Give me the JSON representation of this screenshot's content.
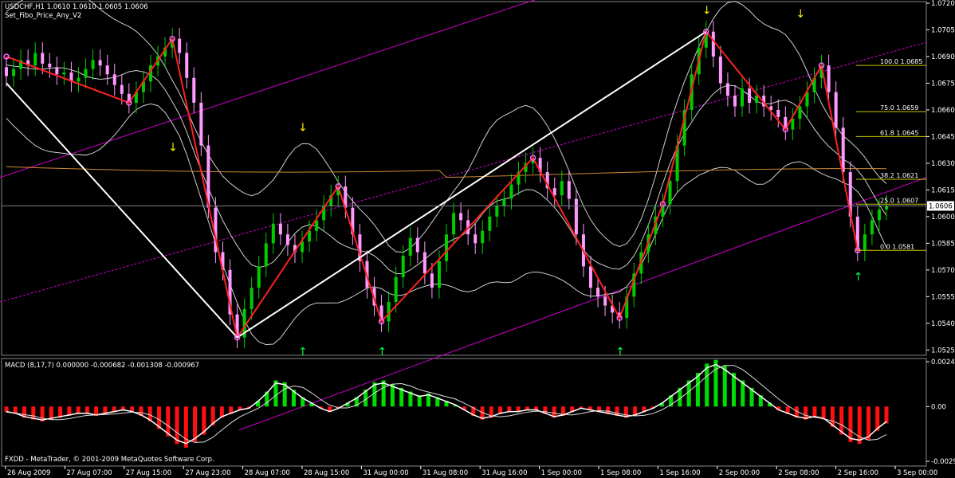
{
  "header": {
    "symbol_line": "USDCHF,H1  1.0610 1.0610 1.0605 1.0606",
    "indicator_name": "Set_Fibo_Price_Any_V2"
  },
  "macd": {
    "label": "MACD  (8,17,7) 0.000000 -0.000682 -0.001308 -0.000967",
    "copyright": "FXDD - MetaTrader, © 2001-2009 MetaQuotes Software Corp."
  },
  "colors": {
    "background": "#000000",
    "bull_candle": "#00cc00",
    "bear_candle": "#ff99ff",
    "zigzag": "#ff2020",
    "channel": "#cc00cc",
    "fibo": "#c8c800",
    "macd_pos": "#00dd00",
    "macd_neg": "#ff1010",
    "bands": "#cfcfcf",
    "ma": "#cc8833",
    "current_price_box": "#ffffff"
  },
  "chart_data": [
    {
      "type": "candlestick",
      "title": "USDCHF,H1",
      "ylim": [
        1.0522,
        1.072
      ],
      "y_ticks": [
        "1.0720",
        "1.0705",
        "1.0690",
        "1.0675",
        "1.0660",
        "1.0645",
        "1.0630",
        "1.0615",
        "1.0600",
        "1.0585",
        "1.0570",
        "1.0555",
        "1.0540",
        "1.0525"
      ],
      "current_price": "1.0606",
      "x_ticks": [
        "26 Aug 2009",
        "27 Aug 07:00",
        "27 Aug 15:00",
        "27 Aug 23:00",
        "28 Aug 07:00",
        "28 Aug 15:00",
        "31 Aug 00:00",
        "31 Aug 08:00",
        "31 Aug 16:00",
        "1 Sep 00:00",
        "1 Sep 08:00",
        "1 Sep 16:00",
        "2 Sep 00:00",
        "2 Sep 08:00",
        "2 Sep 16:00",
        "3 Sep 00:00"
      ],
      "fibo_levels": [
        {
          "label": "100.0  1.0685",
          "price": 1.0685
        },
        {
          "label": "75.0  1.0659",
          "price": 1.0659
        },
        {
          "label": "61.8  1.0645",
          "price": 1.0645
        },
        {
          "label": "38.2  1.0621",
          "price": 1.0621
        },
        {
          "label": "25.0  1.0607",
          "price": 1.0607
        },
        {
          "label": "0.0  1.0581",
          "price": 1.0581
        }
      ],
      "zigzag_red": [
        [
          1.069,
          1.0664
        ],
        [
          1.0664,
          1.07
        ],
        [
          1.07,
          1.0532
        ],
        [
          1.0532,
          1.0617
        ],
        [
          1.0617,
          1.0541
        ],
        [
          1.0541,
          1.0633
        ],
        [
          1.0633,
          1.0543
        ],
        [
          1.0543,
          1.0607
        ],
        [
          1.0607,
          1.0704
        ],
        [
          1.0704,
          1.0649
        ],
        [
          1.0649,
          1.0685
        ],
        [
          1.0685,
          1.0581
        ]
      ],
      "zigzag_white": [
        [
          1.0675,
          1.0532
        ],
        [
          1.0532,
          1.0704
        ]
      ],
      "closes": [
        1.0679,
        1.0683,
        1.0688,
        1.0685,
        1.0692,
        1.0686,
        1.0684,
        1.068,
        1.0681,
        1.0676,
        1.0678,
        1.0683,
        1.0688,
        1.0685,
        1.068,
        1.0674,
        1.0669,
        1.0664,
        1.067,
        1.0676,
        1.0685,
        1.069,
        1.0695,
        1.07,
        1.0692,
        1.0678,
        1.0664,
        1.064,
        1.0605,
        1.058,
        1.057,
        1.0545,
        1.0532,
        1.0548,
        1.056,
        1.0572,
        1.0585,
        1.0596,
        1.059,
        1.0584,
        1.058,
        1.0586,
        1.0592,
        1.0598,
        1.0606,
        1.0612,
        1.0617,
        1.0605,
        1.059,
        1.0575,
        1.056,
        1.055,
        1.0541,
        1.0552,
        1.0566,
        1.0578,
        1.0588,
        1.058,
        1.0568,
        1.056,
        1.0575,
        1.059,
        1.0602,
        1.0598,
        1.059,
        1.0585,
        1.0592,
        1.06,
        1.0606,
        1.061,
        1.0618,
        1.0625,
        1.063,
        1.0633,
        1.0625,
        1.0616,
        1.0612,
        1.062,
        1.061,
        1.059,
        1.0572,
        1.056,
        1.0555,
        1.055,
        1.0546,
        1.0543,
        1.0555,
        1.0568,
        1.058,
        1.059,
        1.06,
        1.0607,
        1.062,
        1.064,
        1.066,
        1.068,
        1.0695,
        1.0704,
        1.069,
        1.0675,
        1.0668,
        1.0662,
        1.0672,
        1.0664,
        1.0668,
        1.0662,
        1.066,
        1.0656,
        1.0649,
        1.0655,
        1.0662,
        1.067,
        1.0678,
        1.0685,
        1.067,
        1.065,
        1.0625,
        1.06,
        1.0581,
        1.059,
        1.0598,
        1.0604,
        1.0606
      ]
    },
    {
      "type": "bar",
      "title": "MACD (8,17,7)",
      "ylim": [
        -0.00293,
        0.0024
      ],
      "y_ticks": [
        "0.00240",
        "0.00",
        "-0.00293"
      ],
      "values": [
        -0.0003,
        -0.0004,
        -0.0006,
        -0.0007,
        -0.0008,
        -0.0007,
        -0.0006,
        -0.0005,
        -0.0004,
        -0.0004,
        -0.0005,
        -0.0004,
        -0.0003,
        -0.0002,
        -0.0003,
        -0.0005,
        -0.0008,
        -0.0012,
        -0.0016,
        -0.002,
        -0.0022,
        -0.0019,
        -0.0015,
        -0.001,
        -0.0006,
        -0.0004,
        -0.0002,
        -0.0001,
        0.0003,
        0.0008,
        0.0014,
        0.0013,
        0.0009,
        0.0005,
        0.0002,
        -0.0001,
        -0.0003,
        -0.0001,
        0.0002,
        0.0005,
        0.0009,
        0.0013,
        0.0014,
        0.0012,
        0.001,
        0.0008,
        0.0006,
        0.0007,
        0.0005,
        0.0003,
        0.0001,
        -0.0002,
        -0.0005,
        -0.0007,
        -0.0006,
        -0.0004,
        -0.0003,
        -0.0003,
        -0.0002,
        -0.0002,
        -0.0004,
        -0.0006,
        -0.0005,
        -0.0003,
        -0.0001,
        -0.0002,
        -0.0003,
        -0.0004,
        -0.0005,
        -0.0006,
        -0.0005,
        -0.0003,
        -0.0001,
        0.0002,
        0.0006,
        0.001,
        0.0014,
        0.0018,
        0.0023,
        0.0025,
        0.0022,
        0.0018,
        0.0014,
        0.001,
        0.0006,
        0.0002,
        -0.0002,
        -0.0004,
        -0.0006,
        -0.0007,
        -0.0006,
        -0.0007,
        -0.0011,
        -0.0015,
        -0.0019,
        -0.002,
        -0.0018,
        -0.0013,
        -0.0009
      ]
    }
  ]
}
